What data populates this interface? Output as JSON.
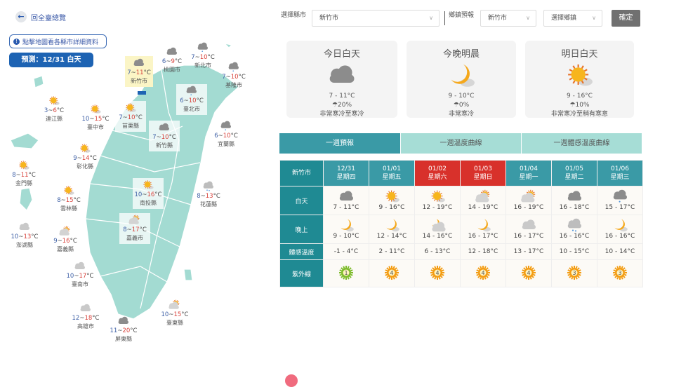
{
  "nav": {
    "back_label": "回全臺總覽",
    "hint": "點擊地圖看各縣市詳細資料",
    "prediction": "預測：12/31 白天"
  },
  "map": {
    "cities": [
      {
        "name": "新竹市",
        "lo": "7",
        "hi": "11",
        "icon": "cloud",
        "selected": true
      },
      {
        "name": "桃園市",
        "lo": "6",
        "hi": "9",
        "icon": "cloud"
      },
      {
        "name": "新北市",
        "lo": "7",
        "hi": "10",
        "icon": "rain"
      },
      {
        "name": "基隆市",
        "lo": "7",
        "hi": "10",
        "icon": "rain"
      },
      {
        "name": "臺北市",
        "lo": "6",
        "hi": "10",
        "icon": "rain"
      },
      {
        "name": "連江縣",
        "lo": "3",
        "hi": "6",
        "icon": "sun"
      },
      {
        "name": "臺中市",
        "lo": "10",
        "hi": "15",
        "icon": "sun"
      },
      {
        "name": "苗栗縣",
        "lo": "7",
        "hi": "10",
        "icon": "sun"
      },
      {
        "name": "新竹縣",
        "lo": "7",
        "hi": "10",
        "icon": "cloud"
      },
      {
        "name": "宜蘭縣",
        "lo": "6",
        "hi": "10",
        "icon": "rain"
      },
      {
        "name": "彰化縣",
        "lo": "9",
        "hi": "14",
        "icon": "sun"
      },
      {
        "name": "金門縣",
        "lo": "8",
        "hi": "11",
        "icon": "sun"
      },
      {
        "name": "雲林縣",
        "lo": "8",
        "hi": "15",
        "icon": "sun"
      },
      {
        "name": "南投縣",
        "lo": "10",
        "hi": "16",
        "icon": "sun"
      },
      {
        "name": "花蓮縣",
        "lo": "8",
        "hi": "13",
        "icon": "rain-light"
      },
      {
        "name": "澎湖縣",
        "lo": "10",
        "hi": "13",
        "icon": "cloud-light"
      },
      {
        "name": "嘉義縣",
        "lo": "9",
        "hi": "16",
        "icon": "partly"
      },
      {
        "name": "嘉義市",
        "lo": "8",
        "hi": "17",
        "icon": "partly"
      },
      {
        "name": "臺南市",
        "lo": "10",
        "hi": "17",
        "icon": "cloud-light"
      },
      {
        "name": "高雄市",
        "lo": "12",
        "hi": "18",
        "icon": "cloud-light"
      },
      {
        "name": "屏東縣",
        "lo": "11",
        "hi": "20",
        "icon": "cloud"
      },
      {
        "name": "臺東縣",
        "lo": "10",
        "hi": "15",
        "icon": "partly"
      }
    ],
    "unit": "°C"
  },
  "filters": {
    "county_label": "選擇縣市",
    "county_value": "新竹市",
    "town_label": "鄉鎮預報",
    "town_county": "新竹市",
    "town_placeholder": "選擇鄉鎮",
    "confirm": "確定"
  },
  "cards": [
    {
      "title": "今日白天",
      "icon": "cloud",
      "temp": "7 - 11°C",
      "rain": "20%",
      "feel": "非常寒冷至寒冷"
    },
    {
      "title": "今晚明晨",
      "icon": "moon",
      "temp": "9 - 10°C",
      "rain": "0%",
      "feel": "非常寒冷"
    },
    {
      "title": "明日白天",
      "icon": "sun",
      "temp": "9 - 16°C",
      "rain": "10%",
      "feel": "非常寒冷至稍有寒意"
    }
  ],
  "tabs": [
    "一週預報",
    "一週溫度曲線",
    "一週體感溫度曲線"
  ],
  "week": {
    "city": "新竹市",
    "row_labels": [
      "白天",
      "晚上",
      "體感溫度",
      "紫外線"
    ],
    "days": [
      {
        "date": "12/31",
        "dow": "星期四",
        "weekend": false,
        "day_icon": "cloud",
        "day": "7 - 11°C",
        "night_icon": "moon",
        "night": "9 - 10°C",
        "feel": "-1 - 4°C",
        "uv": "1"
      },
      {
        "date": "01/01",
        "dow": "星期五",
        "weekend": false,
        "day_icon": "sun",
        "day": "9 - 16°C",
        "night_icon": "moon",
        "night": "12 - 14°C",
        "feel": "2 - 11°C",
        "uv": "4"
      },
      {
        "date": "01/02",
        "dow": "星期六",
        "weekend": true,
        "day_icon": "sun",
        "day": "12 - 19°C",
        "night_icon": "moon-cloud",
        "night": "14 - 16°C",
        "feel": "6 - 13°C",
        "uv": "4"
      },
      {
        "date": "01/03",
        "dow": "星期日",
        "weekend": true,
        "day_icon": "partly",
        "day": "14 - 19°C",
        "night_icon": "moon",
        "night": "16 - 17°C",
        "feel": "12 - 18°C",
        "uv": "4"
      },
      {
        "date": "01/04",
        "dow": "星期一",
        "weekend": false,
        "day_icon": "partly",
        "day": "16 - 19°C",
        "night_icon": "cloud-light",
        "night": "16 - 17°C",
        "feel": "13 - 17°C",
        "uv": "4"
      },
      {
        "date": "01/05",
        "dow": "星期二",
        "weekend": false,
        "day_icon": "cloud",
        "day": "16 - 18°C",
        "night_icon": "rain-light",
        "night": "16 - 16°C",
        "feel": "10 - 15°C",
        "uv": "3"
      },
      {
        "date": "01/06",
        "dow": "星期三",
        "weekend": false,
        "day_icon": "rain",
        "day": "15 - 17°C",
        "night_icon": "moon",
        "night": "16 - 16°C",
        "feel": "10 - 14°C",
        "uv": "3"
      }
    ]
  },
  "colors": {
    "teal": "#3a9aa6",
    "teal_dark": "#1f8a93",
    "weekend": "#d8312b",
    "map": "#a3dbd2",
    "uv_low": "#7dbb2a",
    "uv_mid": "#f39c12"
  }
}
